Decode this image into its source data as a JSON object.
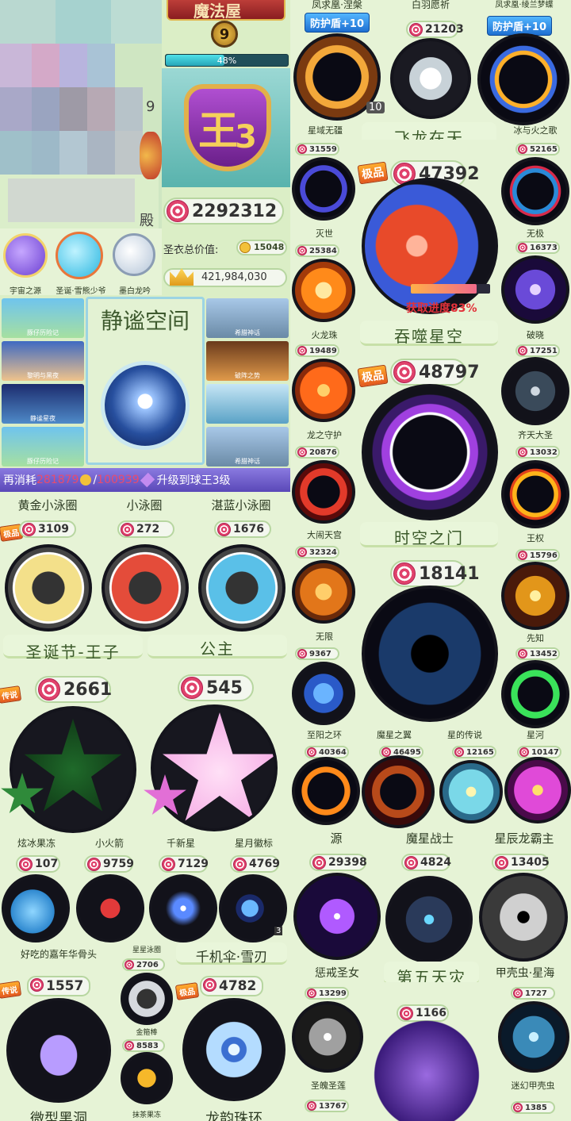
{
  "header": {
    "magic_house": "魔法屋",
    "rank_level": "9",
    "progress_percent": "48%",
    "progress_value": 48,
    "rank_emblem": "王",
    "rank_number": "3",
    "total_candy": "2292312",
    "jersey_label": "圣衣总价值:",
    "jersey_value": "15048",
    "crown_value": "421,984,030",
    "left_partial_number": "9",
    "left_partial_label": "殿"
  },
  "pets": [
    {
      "label": "宇宙之源"
    },
    {
      "label": "圣诞·雪熊少爷"
    },
    {
      "label": "墨白龙吟"
    }
  ],
  "scenes": {
    "title": "静谧空间",
    "left": [
      {
        "label": "豚仔历险记"
      },
      {
        "label": "黎明与黑夜"
      },
      {
        "label": "静谧星夜"
      },
      {
        "label": "豚仔历险记"
      }
    ],
    "right": [
      {
        "label": "希腊神话"
      },
      {
        "label": "破阵之势"
      },
      {
        "label": ""
      },
      {
        "label": "希腊神话"
      }
    ]
  },
  "upgrade": {
    "prefix": "再消耗",
    "cost1": "281879",
    "separator": "/",
    "cost2": "100939",
    "suffix": "升级到球王3级"
  },
  "rings_row": {
    "labels": [
      "黄金小泳圈",
      "小泳圈",
      "湛蓝小泳圈"
    ],
    "prices": [
      "3109",
      "272",
      "1676"
    ],
    "tag": "极品",
    "bottom_labels": [
      "圣诞节-王子",
      "公主"
    ]
  },
  "stars_row": {
    "prices": [
      "2661",
      "545"
    ],
    "tag": "传说",
    "labels": [
      "炫冰果冻",
      "小火箭",
      "千新星",
      "星月徽标"
    ]
  },
  "small_row": {
    "prices": [
      "107",
      "9759",
      "7129",
      "4769"
    ],
    "labels": [
      "好吃的嘉年华骨头",
      "星星泳圈",
      "千机伞·雪刃"
    ],
    "badge": "3"
  },
  "bottom_left": {
    "prices": [
      "1557",
      "2706",
      "8583",
      "4782"
    ],
    "labels": [
      "微型黑洞",
      "金箍棒",
      "抹茶果冻",
      "龙韵珠环"
    ],
    "tags": [
      "传说",
      "极品"
    ]
  },
  "right_top": {
    "top_labels": [
      "凤求凰·涅槃",
      "白羽愿祈",
      "凤求凰·绫兰梦蝶"
    ],
    "shield_label": "防护盾+10",
    "prices": [
      "21203"
    ],
    "count": "10",
    "labels": [
      "星域无疆",
      "飞龙在天",
      "冰与火之歌"
    ]
  },
  "right_grid": {
    "left_col": [
      {
        "price": "31559",
        "label": "灭世"
      },
      {
        "price": "25384",
        "label": "火龙珠"
      },
      {
        "price": "19489",
        "label": "龙之守护"
      },
      {
        "price": "20876",
        "label": "大闹天宫"
      },
      {
        "price": "32324",
        "label": "无限"
      },
      {
        "price": "9367",
        "label": "至阳之环"
      }
    ],
    "right_col": [
      {
        "price": "52165",
        "label": "无极"
      },
      {
        "price": "16373",
        "label": "破晓"
      },
      {
        "price": "17251",
        "label": "齐天大圣"
      },
      {
        "price": "13032",
        "label": "王权"
      },
      {
        "price": "15796",
        "label": "先知"
      },
      {
        "price": "13452",
        "label": "星河"
      }
    ],
    "center": [
      {
        "price": "47392",
        "label": "吞噬星空",
        "progress_label": "获取进度83%",
        "progress_value": 83
      },
      {
        "price": "48797",
        "label": "时空之门"
      },
      {
        "price": "18141",
        "label": "魔星之翼"
      }
    ],
    "star_tag": "极品",
    "extra_label": "星的传说"
  },
  "right_row4": {
    "prices": [
      "40364",
      "46495",
      "12165",
      "10147"
    ],
    "labels": [
      "源",
      "魔星战士",
      "星辰龙霸主"
    ]
  },
  "right_row5": {
    "prices": [
      "29398",
      "4824",
      "13405"
    ],
    "labels": [
      "惩戒圣女",
      "第五天灾",
      "甲壳虫·星海"
    ]
  },
  "right_row6": {
    "prices": [
      "13299",
      "1166",
      "1727",
      "13767",
      "1385"
    ],
    "labels": [
      "圣魄圣莲",
      "迷幻甲壳虫"
    ]
  },
  "colors": {
    "bg": "#dbeec6",
    "accent_pink": "#e0426c",
    "shield_blue": "#1e6fd1",
    "progress_fill": "#3ec6d8",
    "upgrade_bg": "#6c5ac7"
  },
  "icons": [
    "candy-swirl-icon",
    "star-coin-icon",
    "crown-icon",
    "gold-coin-icon",
    "purple-gem-icon"
  ]
}
